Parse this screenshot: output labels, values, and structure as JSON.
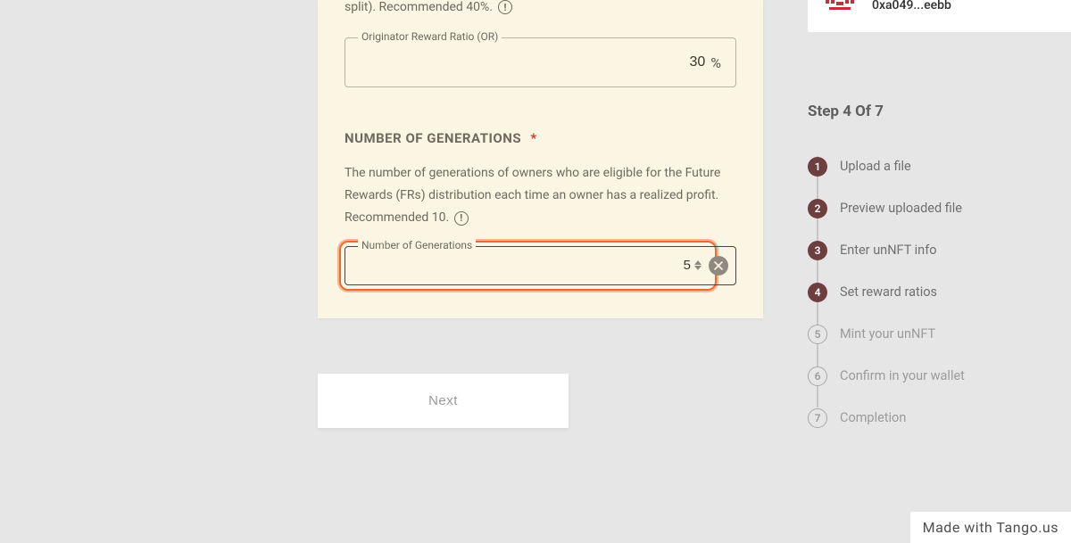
{
  "form": {
    "topLine": "split). Recommended 40%.",
    "field1": {
      "legend": "Originator Reward Ratio (OR)",
      "value": "30",
      "suffix": "%"
    },
    "section": {
      "heading": "NUMBER OF GENERATIONS",
      "asterisk": "*",
      "descPart1": "The number of generations of owners who are eligible for the Future Rewards (FRs) distribution each time an owner has a realized profit. Recommended 10.",
      "legend": "Number of Generations",
      "value": "5"
    },
    "nextLabel": "Next"
  },
  "wallet": {
    "address": "0xa049...eebb"
  },
  "stepper": {
    "title": "Step 4 Of 7",
    "steps": [
      {
        "n": "1",
        "label": "Upload a file"
      },
      {
        "n": "2",
        "label": "Preview uploaded file"
      },
      {
        "n": "3",
        "label": "Enter unNFT info"
      },
      {
        "n": "4",
        "label": "Set reward ratios"
      },
      {
        "n": "5",
        "label": "Mint your unNFT"
      },
      {
        "n": "6",
        "label": "Confirm in your wallet"
      },
      {
        "n": "7",
        "label": "Completion"
      }
    ]
  },
  "watermark": "Made with Tango.us"
}
